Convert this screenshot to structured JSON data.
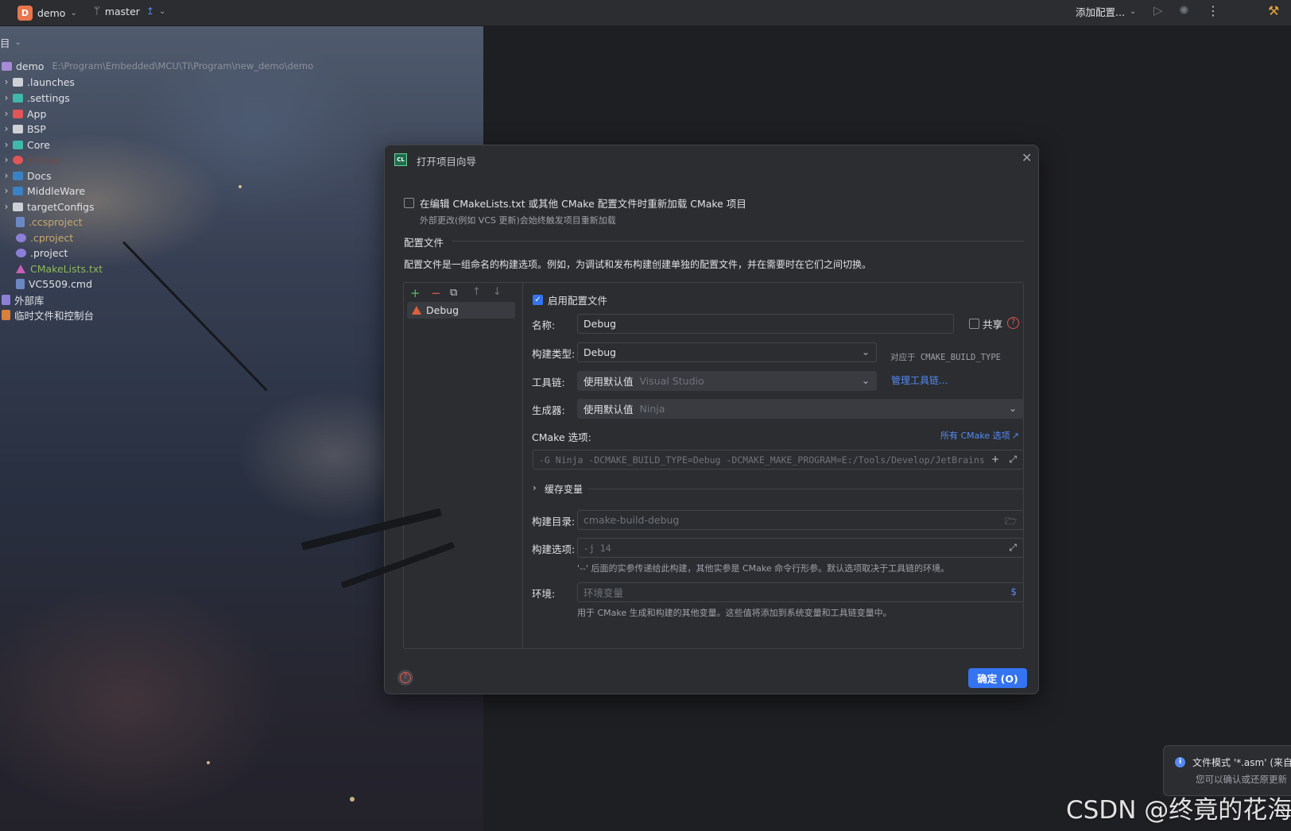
{
  "titlebar": {
    "project_initial": "D",
    "project_name": "demo",
    "branch_name": "master",
    "run_config_label": "添加配置..."
  },
  "project_panel": {
    "header_label": "目",
    "root_name": "demo",
    "root_path": "E:\\Program\\Embedded\\MCU\\TI\\Program\\new_demo\\demo",
    "items": [
      {
        "label": ".launches"
      },
      {
        "label": ".settings"
      },
      {
        "label": "App"
      },
      {
        "label": "BSP"
      },
      {
        "label": "Core"
      },
      {
        "label": "Debug"
      },
      {
        "label": "Docs"
      },
      {
        "label": "MiddleWare"
      },
      {
        "label": "targetConfigs"
      },
      {
        "label": ".ccsproject"
      },
      {
        "label": ".cproject"
      },
      {
        "label": ".project"
      },
      {
        "label": "CMakeLists.txt"
      },
      {
        "label": "VC5509.cmd"
      },
      {
        "label": "外部库"
      },
      {
        "label": "临时文件和控制台"
      }
    ]
  },
  "dialog": {
    "title": "打开项目向导",
    "reload_checkbox_label": "在编辑 CMakeLists.txt 或其他 CMake 配置文件时重新加载 CMake 项目",
    "reload_hint": "外部更改(例如 VCS 更新)会始终触发项目重新加载",
    "section_title": "配置文件",
    "section_desc": "配置文件是一组命名的构建选项。例如，为调试和发布构建创建单独的配置文件，并在需要时在它们之间切换。",
    "profiles": [
      {
        "label": "Debug"
      }
    ],
    "form": {
      "enable_label": "启用配置文件",
      "name_label": "名称:",
      "name_value": "Debug",
      "share_label": "共享",
      "build_type_label": "构建类型:",
      "build_type_value": "Debug",
      "build_type_hint": "对应于 CMAKE_BUILD_TYPE",
      "toolchain_label": "工具链:",
      "toolchain_value": "使用默认值",
      "toolchain_hint": "Visual Studio",
      "manage_toolchains": "管理工具链...",
      "generator_label": "生成器:",
      "generator_value": "使用默认值",
      "generator_hint": "Ninja",
      "cmake_options_label": "CMake 选项:",
      "all_cmake_options": "所有 CMake 选项",
      "cmake_options_value": "-G Ninja -DCMAKE_BUILD_TYPE=Debug -DCMAKE_MAKE_PROGRAM=E:/Tools/Develop/JetBrains",
      "cache_vars_label": "缓存变量",
      "build_dir_label": "构建目录:",
      "build_dir_placeholder": "cmake-build-debug",
      "build_options_label": "构建选项:",
      "build_options_placeholder": "-j 14",
      "build_options_hint": "'--' 后面的实参传递给此构建，其他实参是 CMake 命令行形参。默认选项取决于工具链的环境。",
      "env_label": "环境:",
      "env_placeholder": "环境变量",
      "env_hint": "用于 CMake 生成和构建的其他变量。这些值将添加到系统变量和工具链变量中。"
    },
    "ok_label": "确定 (O)"
  },
  "notification": {
    "title": "文件模式 '*.asm' (来自",
    "body": "您可以确认或还原更新"
  },
  "watermark": "CSDN @终竟的花海"
}
